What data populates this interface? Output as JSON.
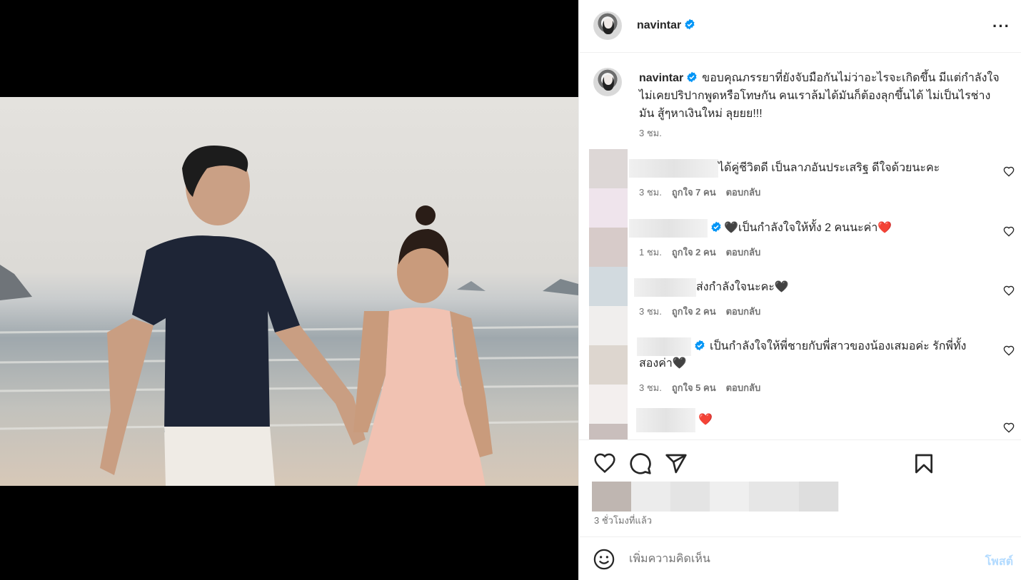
{
  "post": {
    "username": "navintar",
    "more_label": "···",
    "caption": "ขอบคุณภรรยาที่ยังจับมือกันไม่ว่าอะไรจะเกิดขึ้น มีแต่กำลังใจ ไม่เคยปริปากพูดหรือโทษกัน คนเราล้มได้มันก็ต้องลุกขึ้นได้ ไม่เป็นไรช่างมัน สู้ๆหาเงินใหม่ ลุยยย!!!",
    "caption_time": "3 ชม.",
    "time_ago": "3 ชั่วโมงที่แล้ว"
  },
  "comments": [
    {
      "text": "ได้คู่ชีวิตดี เป็นลาภอันประเสริฐ ดีใจด้วยนะคะ",
      "time": "3 ชม.",
      "likes": "ถูกใจ 7 คน",
      "reply": "ตอบกลับ"
    },
    {
      "text": "🖤เป็นกำลังใจให้ทั้ง 2 คนนะค่า❤️",
      "time": "1 ชม.",
      "likes": "ถูกใจ 2 คน",
      "reply": "ตอบกลับ"
    },
    {
      "text": "ส่งกำลังใจนะคะ🖤",
      "time": "3 ชม.",
      "likes": "ถูกใจ 2 คน",
      "reply": "ตอบกลับ"
    },
    {
      "text": "เป็นกำลังใจให้พี่ชายกับพี่สาวของน้องเสมอค่ะ รักพี่ทั้ง",
      "text2": "สองค่า🖤",
      "time": "3 ชม.",
      "likes": "ถูกใจ 5 คน",
      "reply": "ตอบกลับ"
    },
    {
      "text": "❤️"
    }
  ],
  "add_comment": {
    "placeholder": "เพิ่มความคิดเห็น",
    "post_label": "โพสต์"
  },
  "icons": [
    "verified-badge-icon",
    "heart-icon",
    "comment-icon",
    "share-icon",
    "bookmark-icon",
    "emoji-icon",
    "more-icon"
  ],
  "colors": {
    "verified": "#0095f6",
    "post_button_disabled": "#b3dbff",
    "muted": "#737373"
  }
}
